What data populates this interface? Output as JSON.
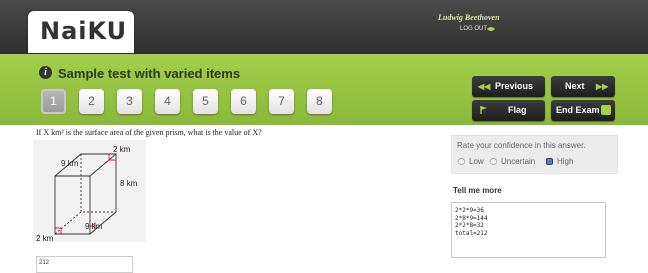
{
  "header": {
    "logo_text": "NaiKU",
    "user_name": "Ludwig Beethoven",
    "logout_label": "LOG OUT"
  },
  "test": {
    "title": "Sample test with varied items",
    "questions": [
      "1",
      "2",
      "3",
      "4",
      "5",
      "6",
      "7",
      "8"
    ],
    "active_question": "1"
  },
  "nav": {
    "previous": "Previous",
    "next": "Next",
    "flag": "Flag",
    "end_exam": "End Exam"
  },
  "question": {
    "text": "If X km² is the surface area of the given prism, what is the value of X?",
    "figure_labels": {
      "top_width": "9 km",
      "top_depth": "2 km",
      "height": "8 km",
      "bottom_width": "9 km",
      "bottom_depth": "2 km"
    },
    "answer": "212"
  },
  "confidence": {
    "title": "Rate your confidence in this answer.",
    "options": [
      "Low",
      "Uncertain",
      "High"
    ],
    "selected": "High"
  },
  "tell_more": {
    "title": "Tell me more",
    "lines": [
      "2*2*9=36",
      "2*8*9=144",
      "2*2*8=32",
      "total=212"
    ]
  },
  "colors": {
    "green": "#a2cf4b",
    "dark_bar": "#3a3a3a",
    "button": "#2a2a2a",
    "accent_icon": "#a6d246"
  }
}
